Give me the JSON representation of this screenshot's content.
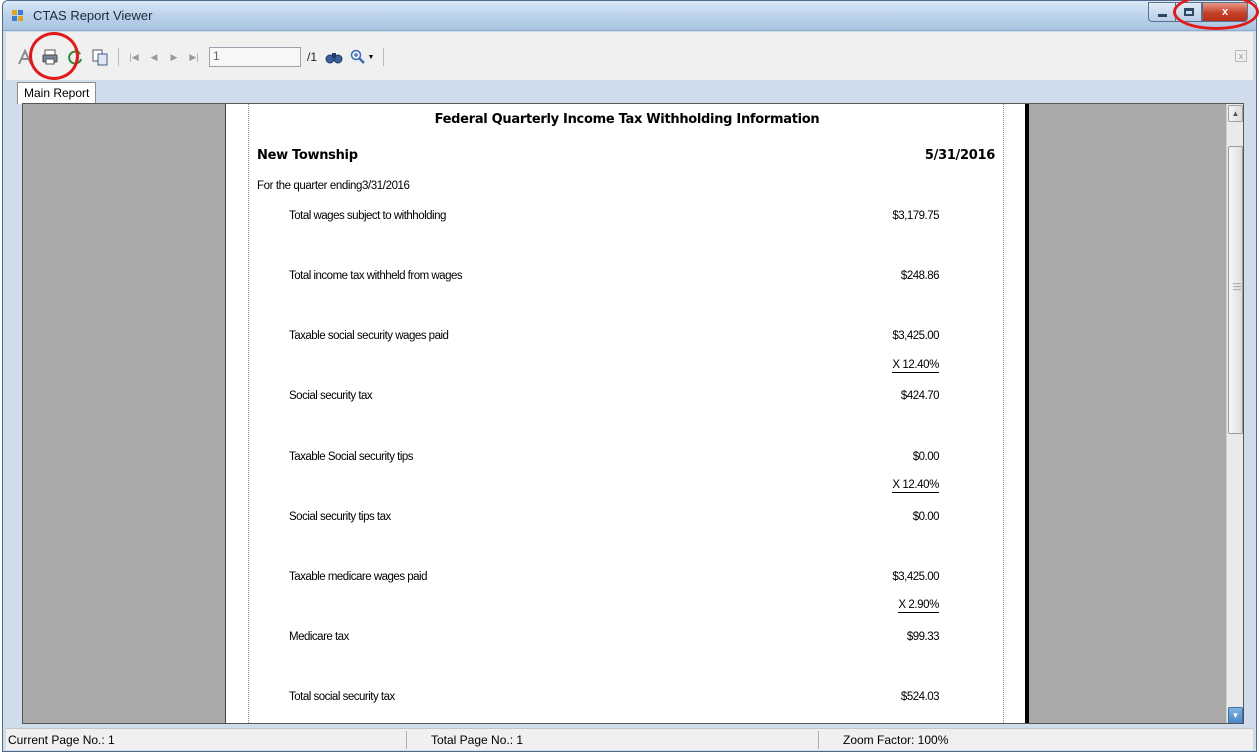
{
  "window": {
    "title": "CTAS Report Viewer",
    "close_symbol": "x"
  },
  "toolbar": {
    "page_input_value": "1",
    "page_total": "/1",
    "icons": [
      "export-icon",
      "print-icon",
      "refresh-icon",
      "copy-icon",
      "first-page-icon",
      "previous-page-icon",
      "next-page-icon",
      "last-page-icon",
      "find-icon",
      "zoom-icon"
    ],
    "close_symbol": "x"
  },
  "tabs": [
    {
      "label": "Main Report"
    }
  ],
  "report": {
    "title": "Federal Quarterly Income Tax Withholding Information",
    "entity": "New Township",
    "date": "5/31/2016",
    "quarter_line": "For the quarter ending3/31/2016",
    "rows": [
      {
        "label": "Total wages subject to withholding",
        "value": "$3,179.75"
      },
      {
        "label": "Total income tax withheld from wages",
        "value": "$248.86"
      },
      {
        "label": "Taxable social security wages paid",
        "value": "$3,425.00",
        "rate": "X 12.40%"
      },
      {
        "label": "Social security tax",
        "value": "$424.70"
      },
      {
        "label": "Taxable Social security tips",
        "value": "$0.00",
        "rate": "X 12.40%"
      },
      {
        "label": "Social security tips tax",
        "value": "$0.00"
      },
      {
        "label": "Taxable medicare wages paid",
        "value": "$3,425.00",
        "rate": "X 2.90%"
      },
      {
        "label": "Medicare tax",
        "value": "$99.33"
      },
      {
        "label": "Total social security tax",
        "value": "$524.03"
      }
    ]
  },
  "statusbar": {
    "current_page": "Current Page No.: 1",
    "total_pages": "Total Page No.: 1",
    "zoom": "Zoom Factor: 100%"
  },
  "colors": {
    "annotation_circle": "#e01a1a",
    "viewer_background": "#a9a9a9",
    "close_button": "#c4412a"
  }
}
